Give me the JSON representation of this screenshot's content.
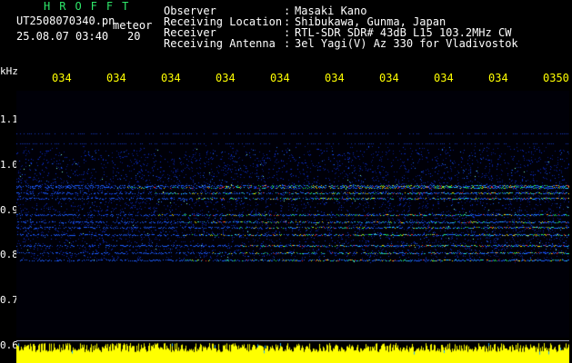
{
  "header": {
    "brand": "HROFFT",
    "filename": "UT2508070340.pn",
    "mode": "meteor",
    "datetime": "25.08.07 03:40",
    "number": "20"
  },
  "info": {
    "separator": ":",
    "observer_label": "Observer",
    "observer_value": "Masaki Kano",
    "location_label": "Receiving Location",
    "location_value": "Shibukawa, Gunma, Japan",
    "receiver_label": "Receiver",
    "receiver_value": "RTL-SDR SDR# 43dB L15 103.2MHz CW",
    "antenna_label": "Receiving Antenna",
    "antenna_value": "3el Yagi(V) Az 330 for Vladivostok"
  },
  "axes": {
    "y_unit": "kHz",
    "y_ticks": [
      "1.1",
      "1.0",
      "0.9",
      "0.8",
      "0.7",
      "0.6"
    ],
    "x_ticks": [
      "034",
      "034",
      "034",
      "034",
      "034",
      "034",
      "034",
      "034",
      "034",
      "0350"
    ]
  },
  "colors": {
    "brand": "#2ee86a",
    "text": "#ffffff",
    "time_ticks": "#ffff00",
    "amplitude_bars": "#ffff00",
    "background": "#000000"
  }
}
